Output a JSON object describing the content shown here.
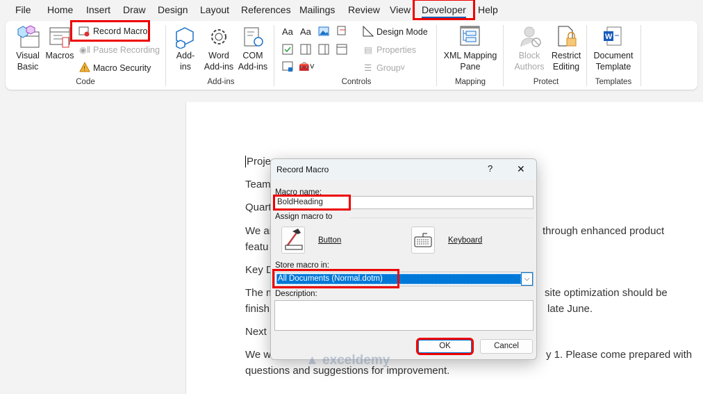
{
  "tabs": [
    "File",
    "Home",
    "Insert",
    "Draw",
    "Design",
    "Layout",
    "References",
    "Mailings",
    "Review",
    "View",
    "Developer",
    "Help"
  ],
  "active_tab": "Developer",
  "ribbon": {
    "code": {
      "visual_basic": "Visual Basic",
      "macros": "Macros",
      "record_macro": "Record Macro",
      "pause_recording": "Pause Recording",
      "macro_security": "Macro Security",
      "group": "Code"
    },
    "addins": {
      "addins": "Add-ins",
      "word_addins": "Word Add-ins",
      "com_addins": "COM Add-ins",
      "group": "Add-ins"
    },
    "controls": {
      "design_mode": "Design Mode",
      "properties": "Properties",
      "group_btn": "Group",
      "group": "Controls"
    },
    "mapping": {
      "xml_pane": "XML Mapping Pane",
      "group": "Mapping"
    },
    "protect": {
      "block_authors": "Block Authors",
      "restrict_editing": "Restrict Editing",
      "group": "Protect"
    },
    "templates": {
      "document_template": "Document Template",
      "group": "Templates"
    }
  },
  "document": {
    "left_fragments": [
      "Projec",
      "Team",
      "Quart",
      "We ai",
      "featu",
      "Key D",
      "The m",
      "finish",
      "Next S",
      "We w"
    ],
    "right_fragments": [
      "through enhanced product",
      "site optimization should be",
      "late June.",
      "y 1. Please come prepared with"
    ],
    "last_line": "questions and suggestions for improvement."
  },
  "dialog": {
    "title": "Record Macro",
    "help": "?",
    "close": "✕",
    "macro_name_label": "Macro name:",
    "macro_name_value": "BoldHeading",
    "assign_label": "Assign macro to",
    "button_label": "Button",
    "keyboard_label": "Keyboard",
    "store_label": "Store macro in:",
    "store_value": "All Documents (Normal.dotm)",
    "description_label": "Description:",
    "description_value": "",
    "ok": "OK",
    "cancel": "Cancel"
  },
  "watermark": "exceldemy",
  "colors": {
    "accent": "#0078d4",
    "highlight": "#e00000",
    "select": "#0078d7"
  }
}
